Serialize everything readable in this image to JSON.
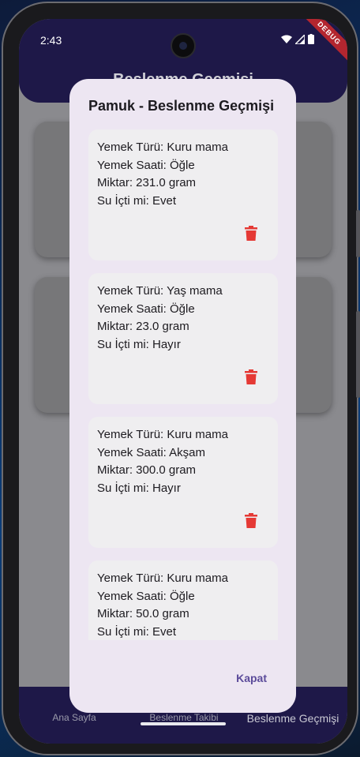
{
  "status": {
    "time": "2:43",
    "debug_label": "DEBUG"
  },
  "appbar": {
    "title": "Beslenme Geçmişi"
  },
  "bottom_nav": {
    "items": [
      {
        "label": "Ana Sayfa"
      },
      {
        "label": "Beslenme Takibi"
      },
      {
        "label": "Beslenme Geçmişi"
      }
    ]
  },
  "dialog": {
    "title": "Pamuk - Beslenme Geçmişi",
    "close_label": "Kapat",
    "entries": [
      {
        "food_type": "Yemek Türü: Kuru mama",
        "meal_time": "Yemek Saati: Öğle",
        "amount": "Miktar: 231.0 gram",
        "water": "Su İçti mi: Evet"
      },
      {
        "food_type": "Yemek Türü: Yaş mama",
        "meal_time": "Yemek Saati: Öğle",
        "amount": "Miktar: 23.0 gram",
        "water": "Su İçti mi: Hayır"
      },
      {
        "food_type": "Yemek Türü: Kuru mama",
        "meal_time": "Yemek Saati: Akşam",
        "amount": "Miktar: 300.0 gram",
        "water": "Su İçti mi: Hayır"
      },
      {
        "food_type": "Yemek Türü: Kuru mama",
        "meal_time": "Yemek Saati: Öğle",
        "amount": "Miktar: 50.0 gram",
        "water": "Su İçti mi: Evet"
      }
    ]
  },
  "icons": {
    "delete": "trash-icon",
    "wifi": "wifi-icon",
    "signal": "signal-icon",
    "battery": "battery-icon"
  },
  "colors": {
    "appbar": "#1e1848",
    "dialog_bg": "#ede6f2",
    "delete_red": "#e53935",
    "accent": "#5b4b9a"
  }
}
